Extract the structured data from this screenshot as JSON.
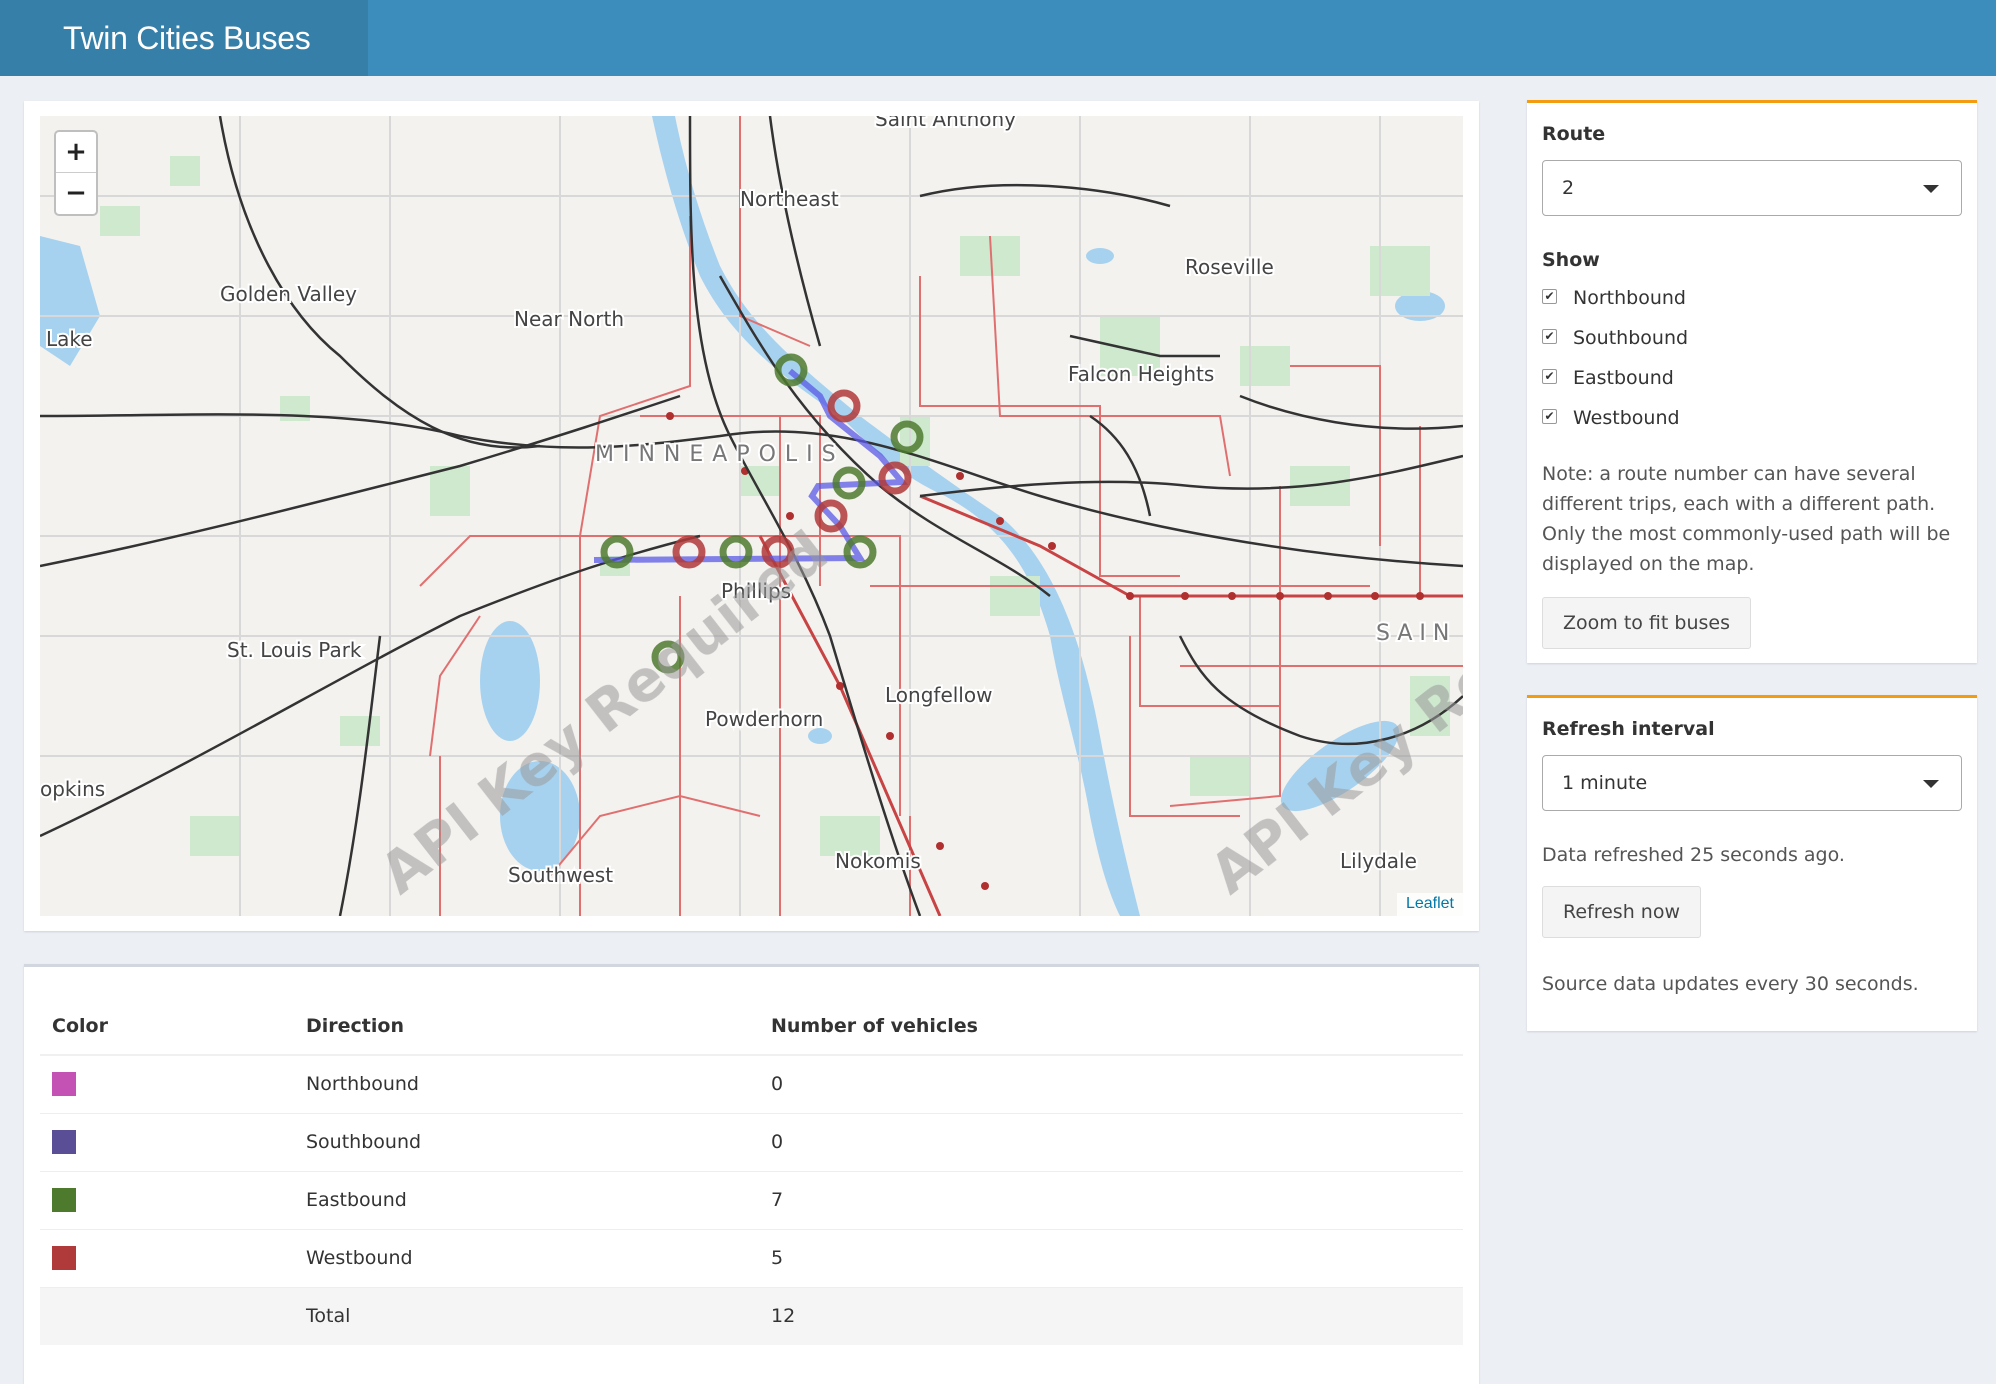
{
  "header": {
    "title": "Twin Cities Buses"
  },
  "map": {
    "zoom_in": "+",
    "zoom_out": "−",
    "attribution": "Leaflet",
    "watermark": "API Key Required",
    "place_labels": [
      "Saint Anthony",
      "Northeast",
      "Roseville",
      "Golden Valley",
      "Near North",
      "Lake",
      "Falcon Heights",
      "MINNEAPOLIS",
      "Phillips",
      "St. Louis Park",
      "SAIN",
      "Longfellow",
      "Powderhorn",
      "opkins",
      "Nokomis",
      "Southwest",
      "Lilydale"
    ],
    "colors": {
      "eastbound": "#4e7a2e",
      "westbound": "#b03a3a",
      "route_path": "#5a5ae6",
      "transit_lines": "#e07070"
    }
  },
  "table": {
    "headers": [
      "Color",
      "Direction",
      "Number of vehicles"
    ],
    "rows": [
      {
        "color": "#c451b4",
        "direction": "Northbound",
        "count": "0"
      },
      {
        "color": "#5a4f97",
        "direction": "Southbound",
        "count": "0"
      },
      {
        "color": "#4e7a2e",
        "direction": "Eastbound",
        "count": "7"
      },
      {
        "color": "#b03a3a",
        "direction": "Westbound",
        "count": "5"
      }
    ],
    "total": {
      "label": "Total",
      "count": "12"
    }
  },
  "route_panel": {
    "route_label": "Route",
    "route_value": "2",
    "show_label": "Show",
    "checkboxes": [
      {
        "label": "Northbound",
        "checked": true
      },
      {
        "label": "Southbound",
        "checked": true
      },
      {
        "label": "Eastbound",
        "checked": true
      },
      {
        "label": "Westbound",
        "checked": true
      }
    ],
    "note_lines": [
      "Note: a route number can have several",
      "different trips, each with a different path.",
      "Only the most commonly-used path will be",
      "displayed on the map."
    ],
    "zoom_button": "Zoom to fit buses"
  },
  "refresh_panel": {
    "label": "Refresh interval",
    "value": "1 minute",
    "status": "Data refreshed 25 seconds ago.",
    "button": "Refresh now",
    "footnote": "Source data updates every 30 seconds."
  },
  "icons": {
    "check": "✔",
    "dropdown": "caret-down"
  }
}
